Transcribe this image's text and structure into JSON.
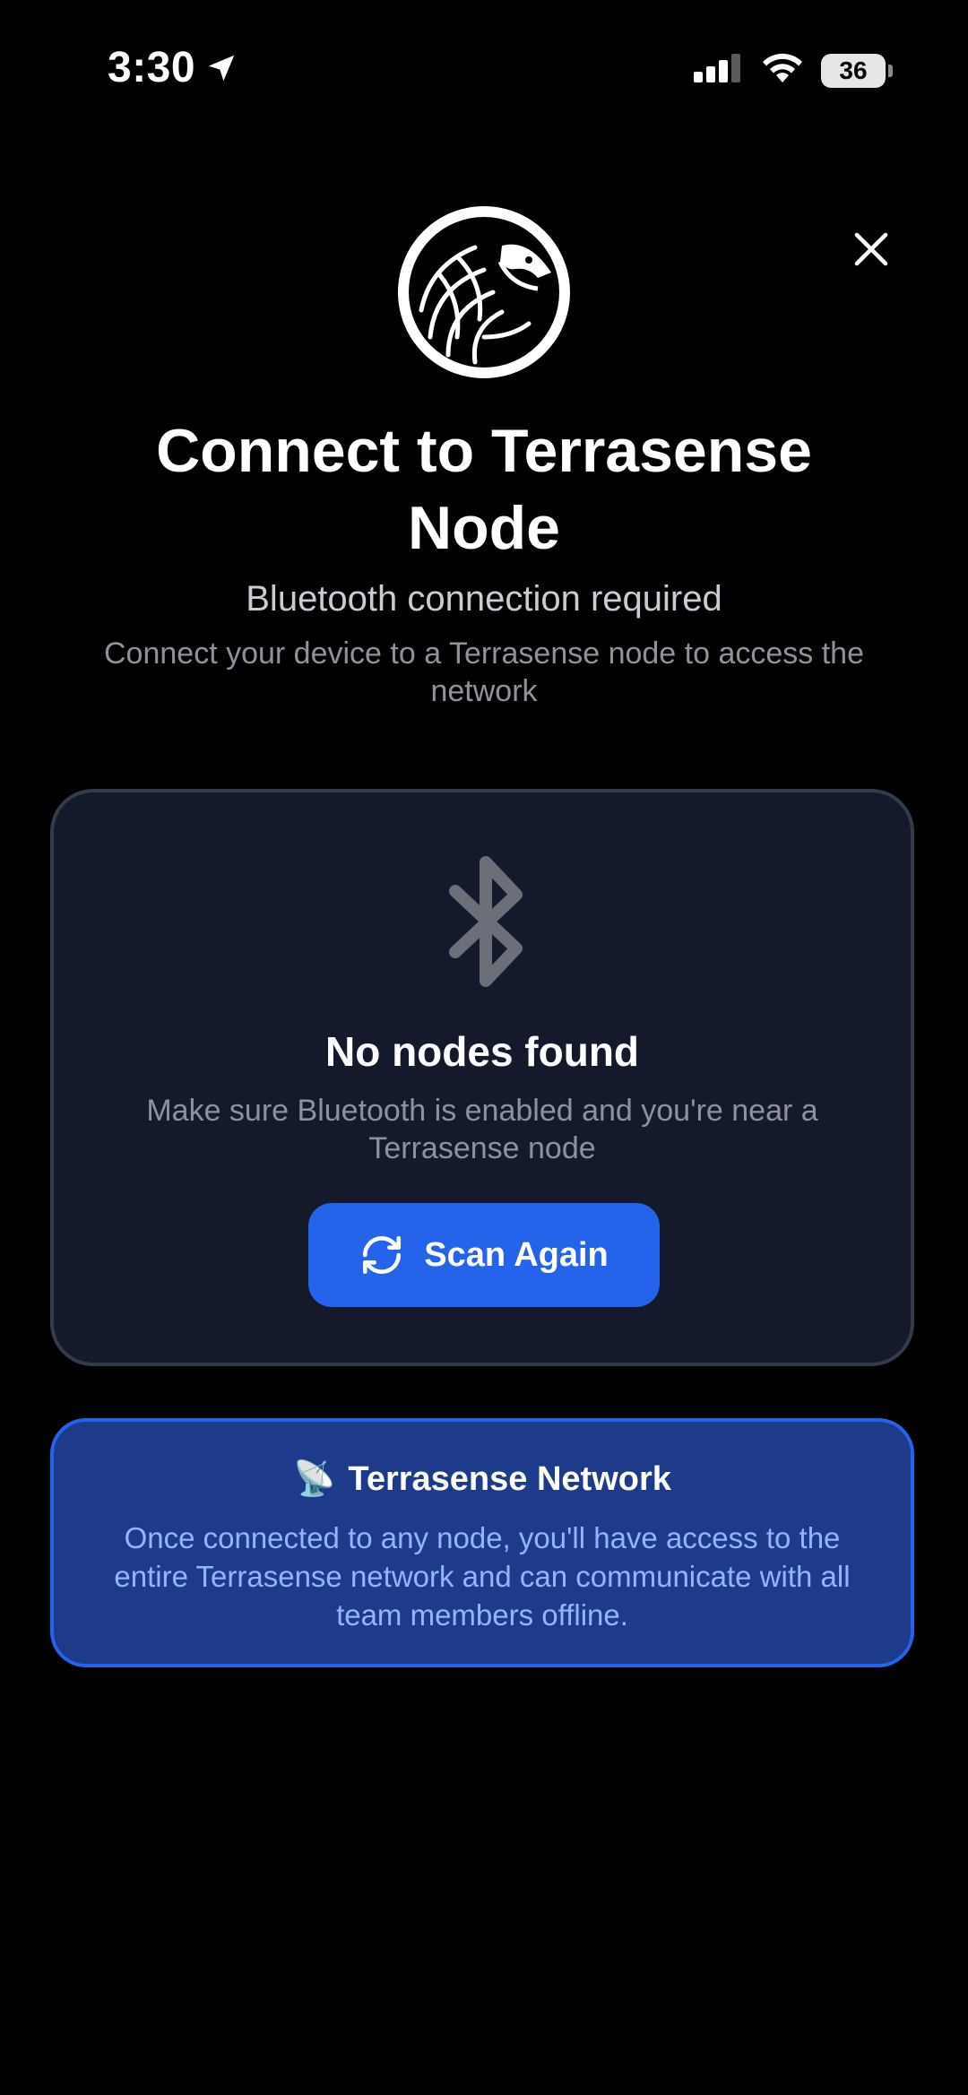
{
  "status_bar": {
    "time": "3:30",
    "battery": "36",
    "location_icon": "location-arrow-icon",
    "signal_icon": "cellular-signal-icon",
    "wifi_icon": "wifi-icon"
  },
  "header": {
    "logo_icon": "terrasense-pangolin-logo",
    "close_icon": "close-icon",
    "title": "Connect to Terrasense Node",
    "subtitle": "Bluetooth connection required",
    "description": "Connect your device to a Terrasense node to access the network"
  },
  "scan_card": {
    "icon": "bluetooth-icon",
    "heading": "No nodes found",
    "hint": "Make sure Bluetooth is enabled and you're near a Terrasense node",
    "button_label": "Scan Again",
    "button_icon": "refresh-icon"
  },
  "network_card": {
    "emoji": "📡",
    "title": "Terrasense Network",
    "body": "Once connected to any node, you'll have access to the entire Terrasense network and can communicate with all team members offline."
  },
  "colors": {
    "background": "#000000",
    "card_background": "#141a2b",
    "card_border": "#343b4a",
    "accent_blue": "#2563eb",
    "info_card_background": "#1e3a8a",
    "info_card_text": "#93b4ff",
    "muted_text": "#8e929b"
  }
}
